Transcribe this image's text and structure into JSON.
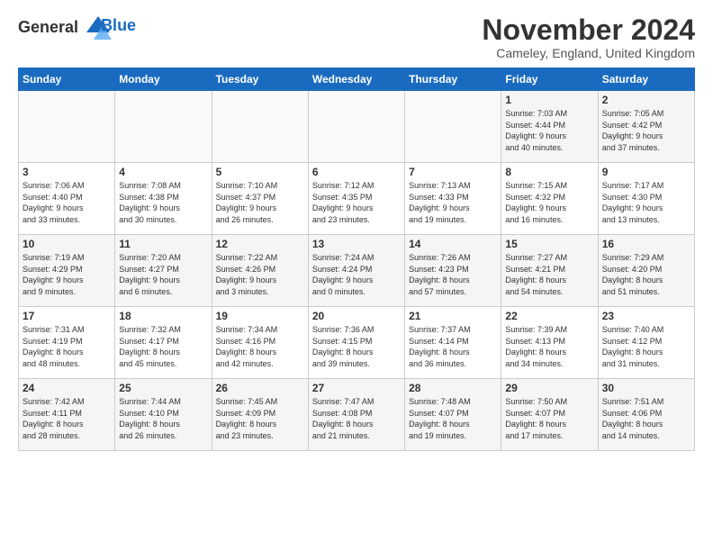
{
  "logo": {
    "line1": "General",
    "line2": "Blue"
  },
  "title": "November 2024",
  "subtitle": "Cameley, England, United Kingdom",
  "days_of_week": [
    "Sunday",
    "Monday",
    "Tuesday",
    "Wednesday",
    "Thursday",
    "Friday",
    "Saturday"
  ],
  "weeks": [
    [
      {
        "day": "",
        "info": ""
      },
      {
        "day": "",
        "info": ""
      },
      {
        "day": "",
        "info": ""
      },
      {
        "day": "",
        "info": ""
      },
      {
        "day": "",
        "info": ""
      },
      {
        "day": "1",
        "info": "Sunrise: 7:03 AM\nSunset: 4:44 PM\nDaylight: 9 hours\nand 40 minutes."
      },
      {
        "day": "2",
        "info": "Sunrise: 7:05 AM\nSunset: 4:42 PM\nDaylight: 9 hours\nand 37 minutes."
      }
    ],
    [
      {
        "day": "3",
        "info": "Sunrise: 7:06 AM\nSunset: 4:40 PM\nDaylight: 9 hours\nand 33 minutes."
      },
      {
        "day": "4",
        "info": "Sunrise: 7:08 AM\nSunset: 4:38 PM\nDaylight: 9 hours\nand 30 minutes."
      },
      {
        "day": "5",
        "info": "Sunrise: 7:10 AM\nSunset: 4:37 PM\nDaylight: 9 hours\nand 26 minutes."
      },
      {
        "day": "6",
        "info": "Sunrise: 7:12 AM\nSunset: 4:35 PM\nDaylight: 9 hours\nand 23 minutes."
      },
      {
        "day": "7",
        "info": "Sunrise: 7:13 AM\nSunset: 4:33 PM\nDaylight: 9 hours\nand 19 minutes."
      },
      {
        "day": "8",
        "info": "Sunrise: 7:15 AM\nSunset: 4:32 PM\nDaylight: 9 hours\nand 16 minutes."
      },
      {
        "day": "9",
        "info": "Sunrise: 7:17 AM\nSunset: 4:30 PM\nDaylight: 9 hours\nand 13 minutes."
      }
    ],
    [
      {
        "day": "10",
        "info": "Sunrise: 7:19 AM\nSunset: 4:29 PM\nDaylight: 9 hours\nand 9 minutes."
      },
      {
        "day": "11",
        "info": "Sunrise: 7:20 AM\nSunset: 4:27 PM\nDaylight: 9 hours\nand 6 minutes."
      },
      {
        "day": "12",
        "info": "Sunrise: 7:22 AM\nSunset: 4:26 PM\nDaylight: 9 hours\nand 3 minutes."
      },
      {
        "day": "13",
        "info": "Sunrise: 7:24 AM\nSunset: 4:24 PM\nDaylight: 9 hours\nand 0 minutes."
      },
      {
        "day": "14",
        "info": "Sunrise: 7:26 AM\nSunset: 4:23 PM\nDaylight: 8 hours\nand 57 minutes."
      },
      {
        "day": "15",
        "info": "Sunrise: 7:27 AM\nSunset: 4:21 PM\nDaylight: 8 hours\nand 54 minutes."
      },
      {
        "day": "16",
        "info": "Sunrise: 7:29 AM\nSunset: 4:20 PM\nDaylight: 8 hours\nand 51 minutes."
      }
    ],
    [
      {
        "day": "17",
        "info": "Sunrise: 7:31 AM\nSunset: 4:19 PM\nDaylight: 8 hours\nand 48 minutes."
      },
      {
        "day": "18",
        "info": "Sunrise: 7:32 AM\nSunset: 4:17 PM\nDaylight: 8 hours\nand 45 minutes."
      },
      {
        "day": "19",
        "info": "Sunrise: 7:34 AM\nSunset: 4:16 PM\nDaylight: 8 hours\nand 42 minutes."
      },
      {
        "day": "20",
        "info": "Sunrise: 7:36 AM\nSunset: 4:15 PM\nDaylight: 8 hours\nand 39 minutes."
      },
      {
        "day": "21",
        "info": "Sunrise: 7:37 AM\nSunset: 4:14 PM\nDaylight: 8 hours\nand 36 minutes."
      },
      {
        "day": "22",
        "info": "Sunrise: 7:39 AM\nSunset: 4:13 PM\nDaylight: 8 hours\nand 34 minutes."
      },
      {
        "day": "23",
        "info": "Sunrise: 7:40 AM\nSunset: 4:12 PM\nDaylight: 8 hours\nand 31 minutes."
      }
    ],
    [
      {
        "day": "24",
        "info": "Sunrise: 7:42 AM\nSunset: 4:11 PM\nDaylight: 8 hours\nand 28 minutes."
      },
      {
        "day": "25",
        "info": "Sunrise: 7:44 AM\nSunset: 4:10 PM\nDaylight: 8 hours\nand 26 minutes."
      },
      {
        "day": "26",
        "info": "Sunrise: 7:45 AM\nSunset: 4:09 PM\nDaylight: 8 hours\nand 23 minutes."
      },
      {
        "day": "27",
        "info": "Sunrise: 7:47 AM\nSunset: 4:08 PM\nDaylight: 8 hours\nand 21 minutes."
      },
      {
        "day": "28",
        "info": "Sunrise: 7:48 AM\nSunset: 4:07 PM\nDaylight: 8 hours\nand 19 minutes."
      },
      {
        "day": "29",
        "info": "Sunrise: 7:50 AM\nSunset: 4:07 PM\nDaylight: 8 hours\nand 17 minutes."
      },
      {
        "day": "30",
        "info": "Sunrise: 7:51 AM\nSunset: 4:06 PM\nDaylight: 8 hours\nand 14 minutes."
      }
    ]
  ]
}
